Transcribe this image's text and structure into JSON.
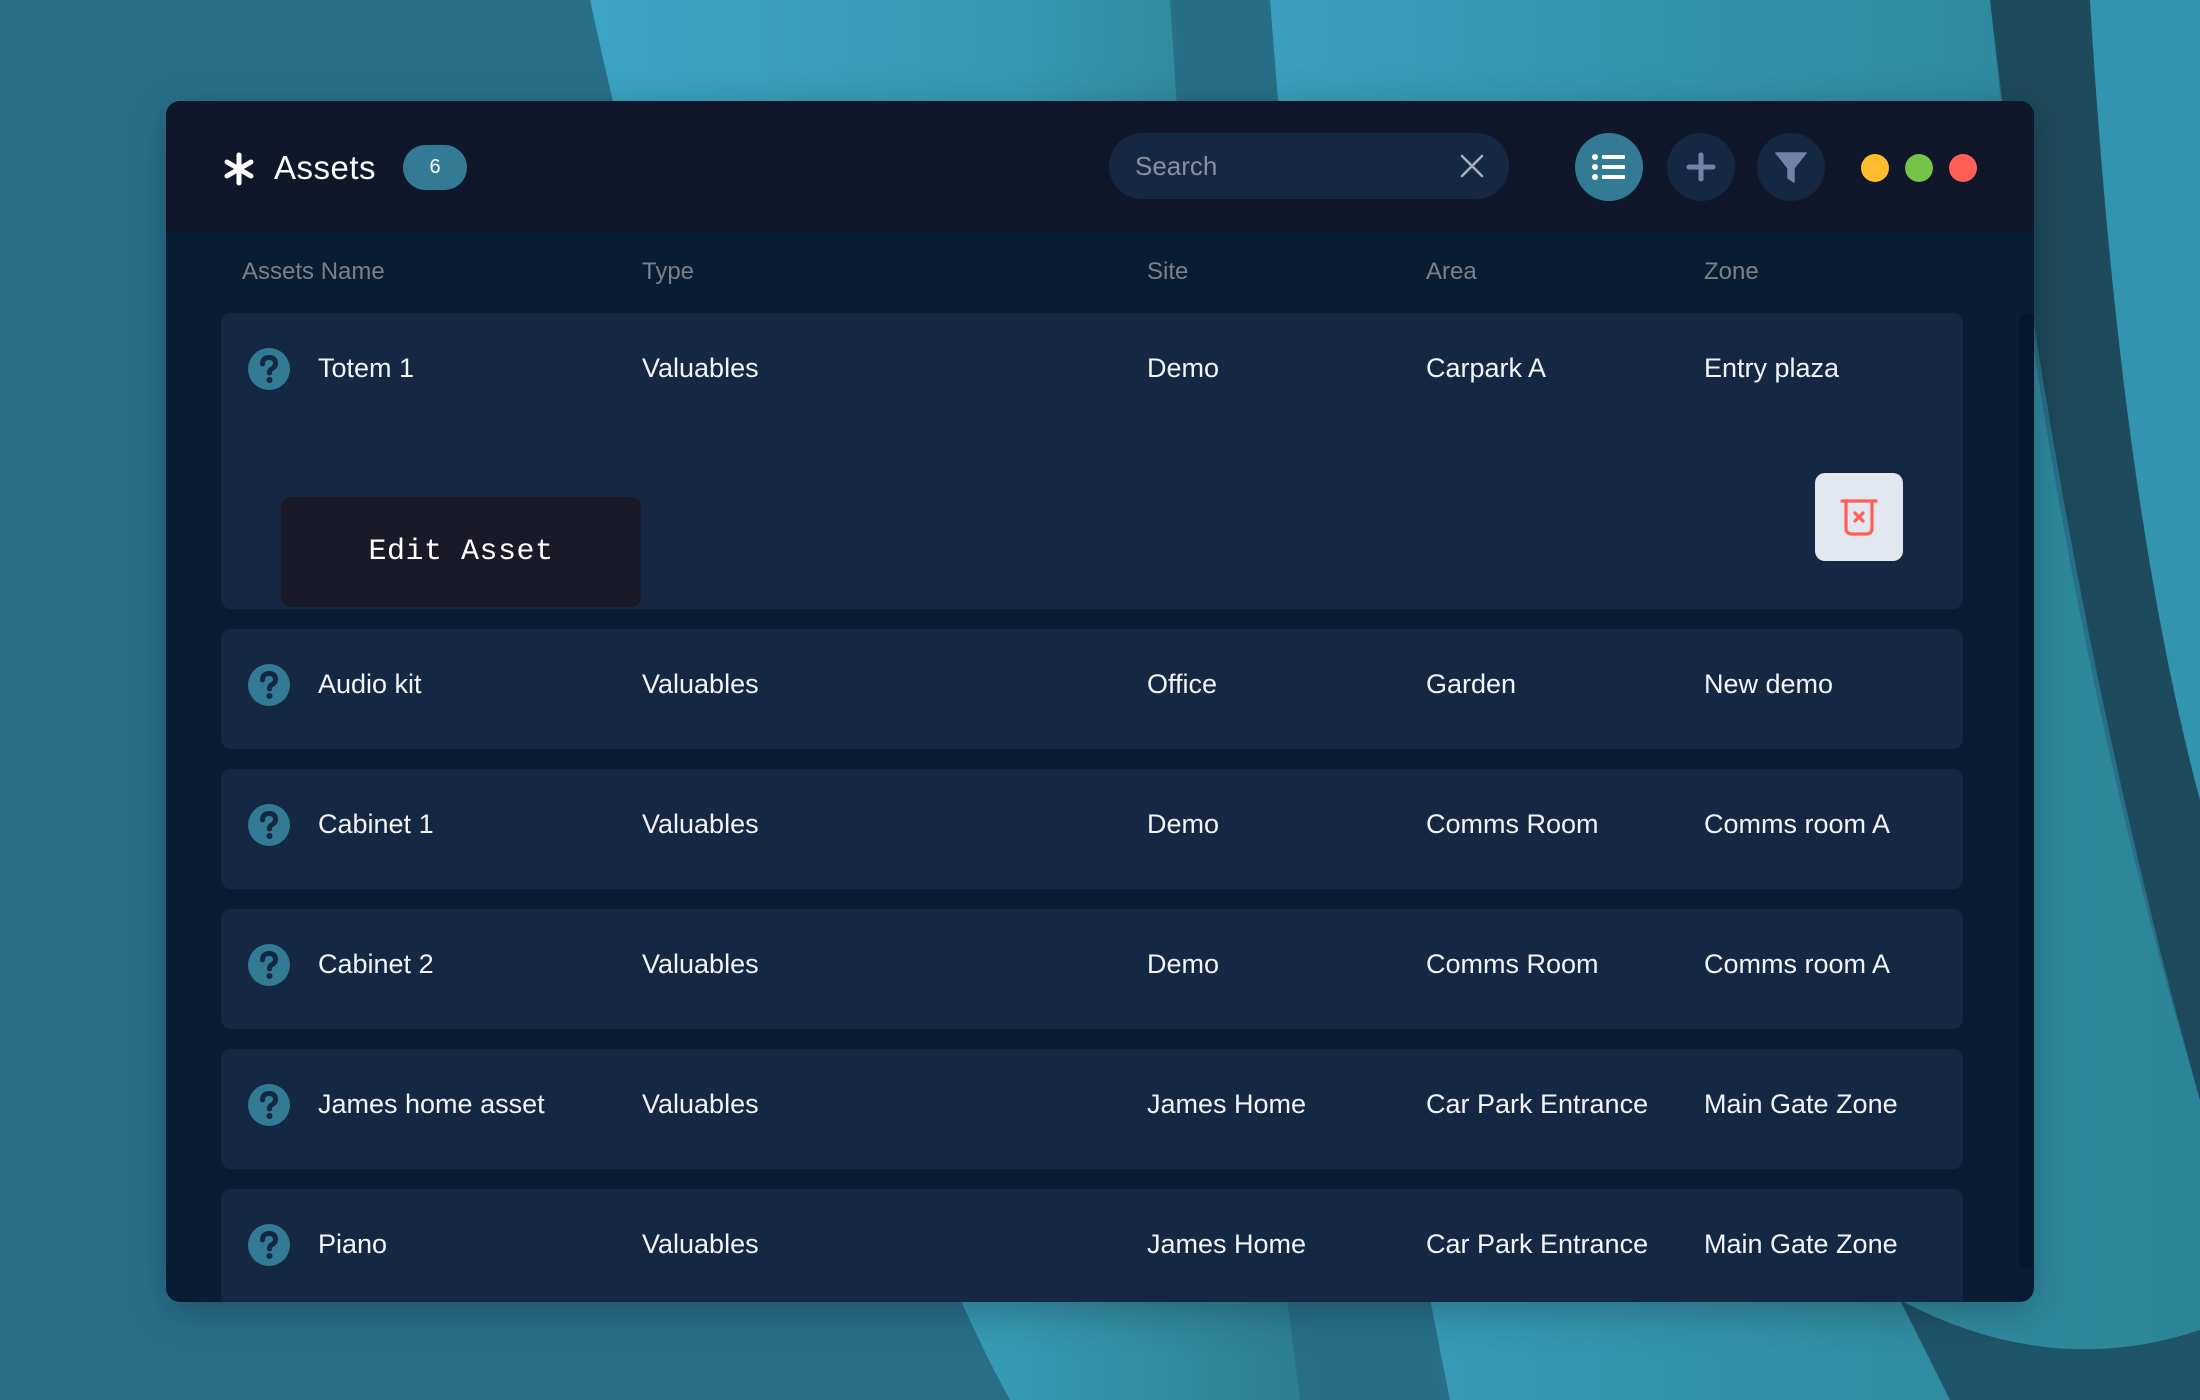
{
  "app": {
    "title": "Assets",
    "icon": "asterisk-icon",
    "count_badge": "6"
  },
  "search": {
    "placeholder": "Search",
    "value": "",
    "clear_icon": "close-icon"
  },
  "toolbar": {
    "buttons": [
      {
        "name": "list-view",
        "icon": "list-icon",
        "active": true
      },
      {
        "name": "add",
        "icon": "plus-icon",
        "active": false
      },
      {
        "name": "filter",
        "icon": "filter-icon",
        "active": false
      }
    ],
    "window_controls": [
      {
        "name": "minimize",
        "color": "#ffbd2e"
      },
      {
        "name": "maximize",
        "color": "#76c447"
      },
      {
        "name": "close",
        "color": "#ff5f57"
      }
    ]
  },
  "colors": {
    "accent": "#337a94",
    "titlebar": "#10172a",
    "panel": "#081d33",
    "row": "#142844",
    "danger": "#ff5f57"
  },
  "table": {
    "columns": [
      "Assets Name",
      "Type",
      "Site",
      "Area",
      "Zone"
    ],
    "rows": [
      {
        "name": "Totem 1",
        "type": "Valuables",
        "site": "Demo",
        "area": "Carpark A",
        "zone": "Entry plaza",
        "expanded": true,
        "status_icon": "question-icon"
      },
      {
        "name": "Audio kit",
        "type": "Valuables",
        "site": "Office",
        "area": "Garden",
        "zone": "New demo",
        "expanded": false,
        "status_icon": "question-icon"
      },
      {
        "name": "Cabinet 1",
        "type": "Valuables",
        "site": "Demo",
        "area": "Comms Room",
        "zone": "Comms room A",
        "expanded": false,
        "status_icon": "question-icon"
      },
      {
        "name": "Cabinet 2",
        "type": "Valuables",
        "site": "Demo",
        "area": "Comms Room",
        "zone": "Comms room A",
        "expanded": false,
        "status_icon": "question-icon"
      },
      {
        "name": "James home asset",
        "type": "Valuables",
        "site": "James Home",
        "area": "Car Park Entrance",
        "zone": "Main Gate Zone",
        "expanded": false,
        "status_icon": "question-icon"
      },
      {
        "name": "Piano",
        "type": "Valuables",
        "site": "James Home",
        "area": "Car Park Entrance",
        "zone": "Main Gate Zone",
        "expanded": false,
        "status_icon": "question-icon"
      }
    ]
  },
  "expanded_actions": {
    "edit_label": "Edit Asset",
    "delete_icon": "trash-icon"
  }
}
